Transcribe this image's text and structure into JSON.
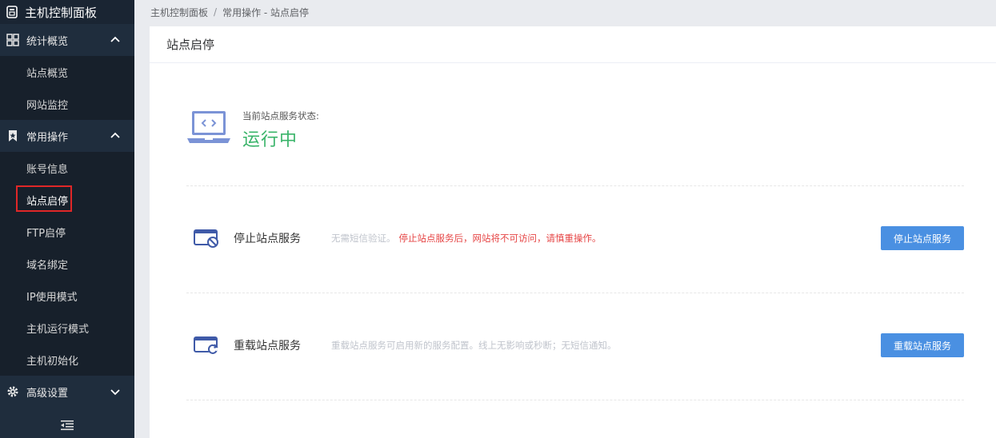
{
  "sidebar": {
    "brand": "主机控制面板",
    "groups": [
      {
        "label": "统计概览",
        "items": [
          "站点概览",
          "网站监控"
        ]
      },
      {
        "label": "常用操作",
        "items": [
          "账号信息",
          "站点启停",
          "FTP启停",
          "域名绑定",
          "IP使用模式",
          "主机运行模式",
          "主机初始化"
        ]
      },
      {
        "label": "高级设置"
      }
    ],
    "active_item": "站点启停"
  },
  "breadcrumb": {
    "root": "主机控制面板",
    "sep": "/",
    "current": "常用操作 - 站点启停"
  },
  "panel": {
    "title": "站点启停",
    "status_label": "当前站点服务状态:",
    "status_value": "运行中"
  },
  "operations": [
    {
      "name": "停止站点服务",
      "desc": "无需短信验证。",
      "warn": "停止站点服务后，网站将不可访问，请慎重操作。",
      "button": "停止站点服务"
    },
    {
      "name": "重载站点服务",
      "desc": "重载站点服务可启用新的服务配置。线上无影响或秒断；无短信通知。",
      "warn": "",
      "button": "重载站点服务"
    }
  ],
  "colors": {
    "sidebar": "#1f2d3d",
    "accent": "#4a90e2",
    "status_running": "#3ab46a",
    "warning": "#e64545"
  }
}
